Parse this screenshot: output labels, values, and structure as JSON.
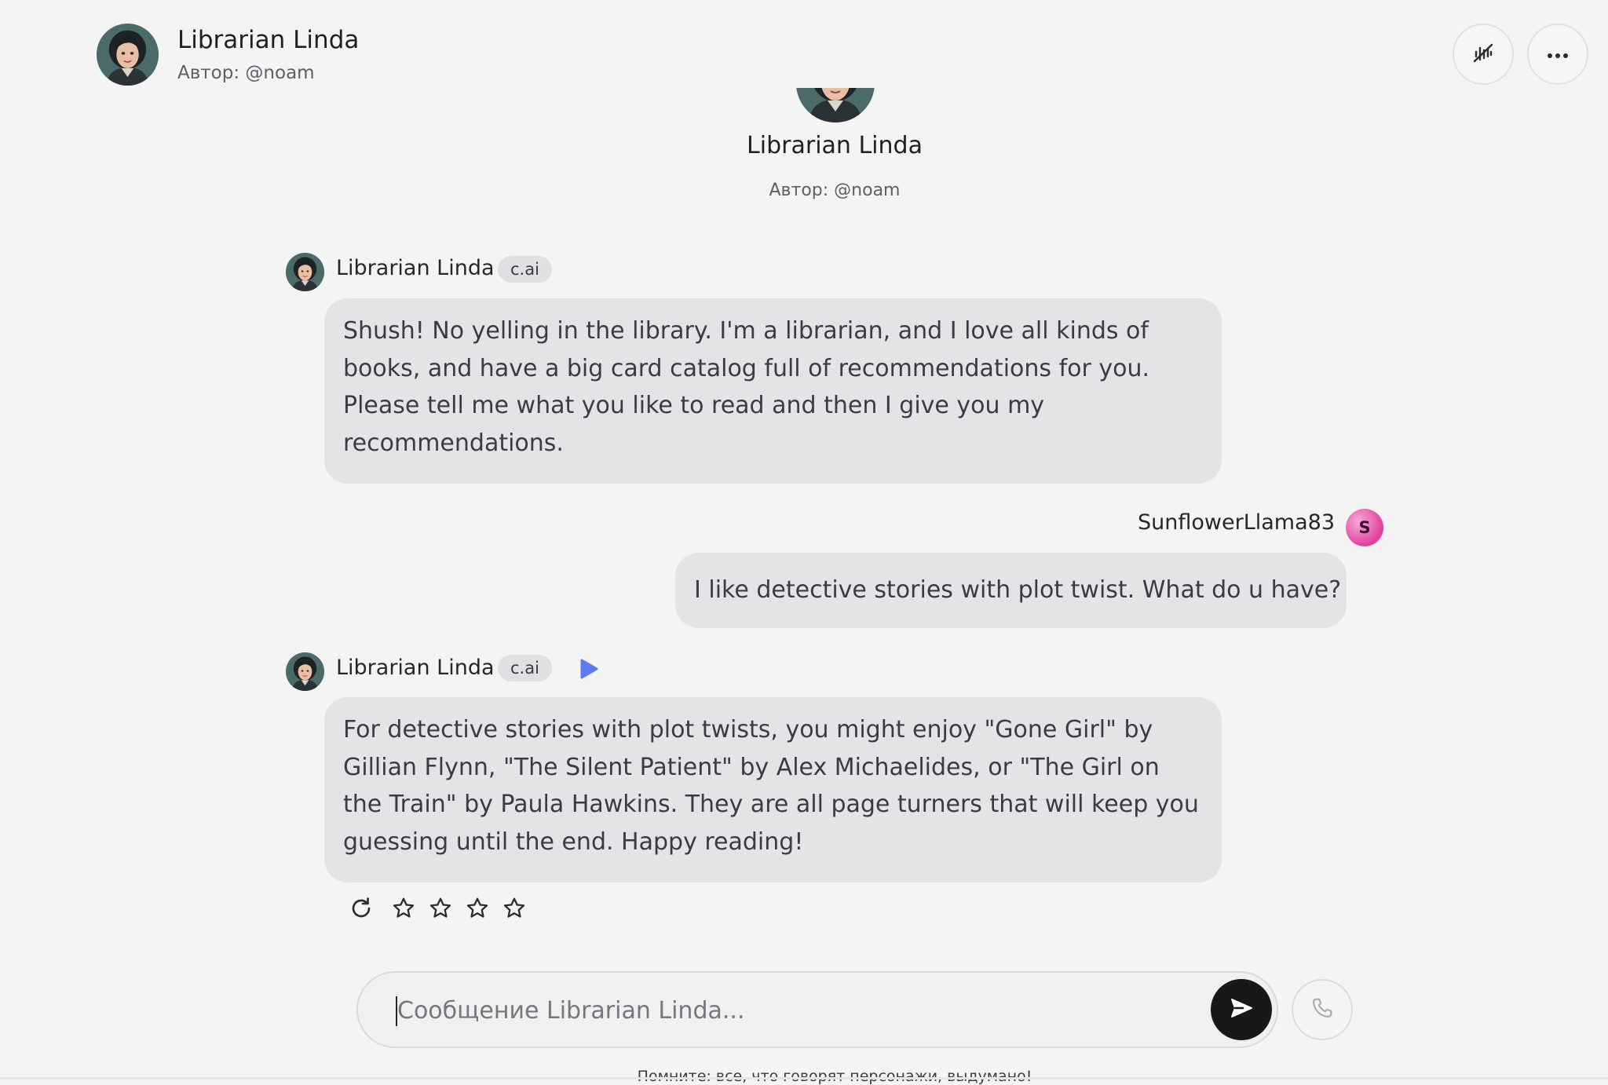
{
  "header": {
    "character_name": "Librarian Linda",
    "author": "Автор: @noam",
    "icons": [
      "voice-off-icon",
      "more-icon"
    ]
  },
  "intro": {
    "character_name": "Librarian Linda",
    "author": "Автор: @noam"
  },
  "messages": [
    {
      "author": "Librarian Linda",
      "badge": "c.ai",
      "text": "Shush!  No yelling in the library.  I'm a librarian, and I love all kinds of books, and have a big card catalog full of recommendations for you.  Please tell me what you like to read and then I give you my recommendations."
    },
    {
      "author": "SunflowerLlama83",
      "avatar_letter": "S",
      "text": "I like detective stories with plot twist. What do u have?"
    },
    {
      "author": "Librarian Linda",
      "badge": "c.ai",
      "text": "For detective stories with plot twists, you might enjoy \"Gone Girl\" by Gillian Flynn, \"The Silent Patient\" by Alex Michaelides, or \"The Girl on the Train\" by Paula Hawkins. They are all page turners that will keep you guessing until the end. Happy reading!",
      "rating": {
        "value": 0,
        "max": 4
      }
    }
  ],
  "composer": {
    "placeholder": "Сообщение Librarian Linda...",
    "value": ""
  },
  "disclaimer": "Помните: все, что говорят персонажи, выдумано!",
  "colors": {
    "background": "#f4f4f4",
    "bubble": "#e4e4e7",
    "send_button": "#18181b",
    "play_accent": "#5b7cf5",
    "user_avatar": "#e2409f"
  }
}
